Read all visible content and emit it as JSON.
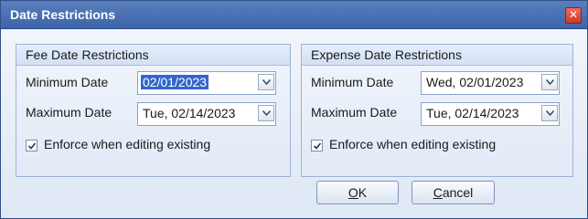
{
  "window": {
    "title": "Date Restrictions",
    "close_glyph": "✕"
  },
  "fee": {
    "header": "Fee Date Restrictions",
    "min_label": "Minimum Date",
    "min_value": "02/01/2023",
    "max_label": "Maximum Date",
    "max_value": "Tue, 02/14/2023",
    "enforce_label": "Enforce when editing existing",
    "enforce_checked": true
  },
  "expense": {
    "header": "Expense Date Restrictions",
    "min_label": "Minimum Date",
    "min_value": "Wed, 02/01/2023",
    "max_label": "Maximum Date",
    "max_value": "Tue, 02/14/2023",
    "enforce_label": "Enforce when editing existing",
    "enforce_checked": true
  },
  "buttons": {
    "ok_mnemonic": "O",
    "ok_rest": "K",
    "cancel_mnemonic": "C",
    "cancel_rest": "ancel"
  },
  "icons": {
    "close": "close-icon",
    "dropdown": "chevron-down-icon",
    "check": "checkmark-icon"
  }
}
